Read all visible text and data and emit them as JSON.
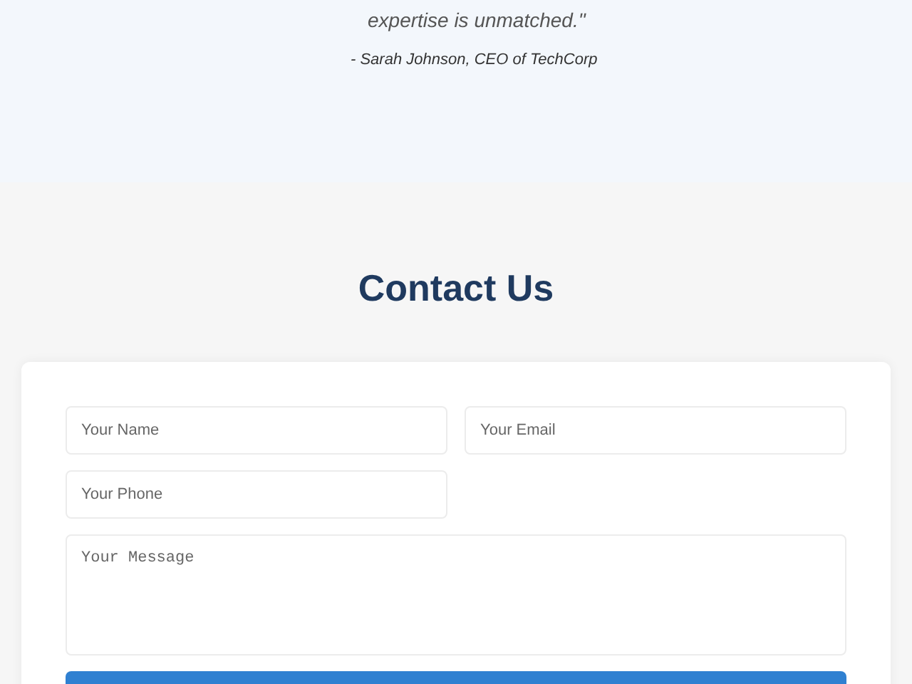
{
  "testimonial": {
    "quote": "expertise is unmatched.\"",
    "author": "- Sarah Johnson, CEO of TechCorp"
  },
  "contact": {
    "title": "Contact Us",
    "fields": [
      {
        "kind": "input",
        "placeholder": "Your Name"
      },
      {
        "kind": "input",
        "placeholder": "Your Email"
      },
      {
        "kind": "input",
        "placeholder": "Your Phone"
      },
      {
        "kind": "textarea",
        "placeholder": "Your Message"
      }
    ]
  }
}
